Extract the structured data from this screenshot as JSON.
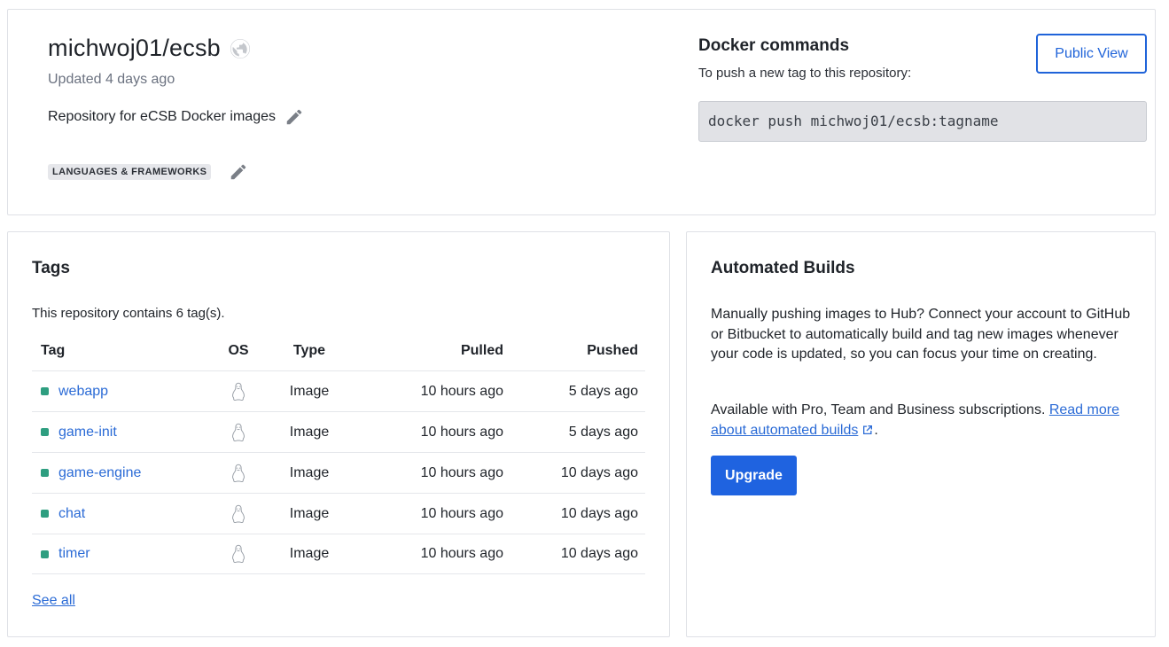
{
  "repo": {
    "name": "michwoj01/ecsb",
    "visibility_icon": "globe-icon",
    "updated": "Updated 4 days ago",
    "description": "Repository for eCSB Docker images",
    "category": "LANGUAGES & FRAMEWORKS"
  },
  "docker": {
    "title": "Docker commands",
    "subtitle": "To push a new tag to this repository:",
    "command": "docker push michwoj01/ecsb:tagname",
    "public_view_label": "Public View"
  },
  "tags": {
    "title": "Tags",
    "count_text": "This repository contains 6 tag(s).",
    "columns": {
      "tag": "Tag",
      "os": "OS",
      "type": "Type",
      "pulled": "Pulled",
      "pushed": "Pushed"
    },
    "rows": [
      {
        "tag": "webapp",
        "os_icon": "linux-icon",
        "type": "Image",
        "pulled": "10 hours ago",
        "pushed": "5 days ago"
      },
      {
        "tag": "game-init",
        "os_icon": "linux-icon",
        "type": "Image",
        "pulled": "10 hours ago",
        "pushed": "5 days ago"
      },
      {
        "tag": "game-engine",
        "os_icon": "linux-icon",
        "type": "Image",
        "pulled": "10 hours ago",
        "pushed": "10 days ago"
      },
      {
        "tag": "chat",
        "os_icon": "linux-icon",
        "type": "Image",
        "pulled": "10 hours ago",
        "pushed": "10 days ago"
      },
      {
        "tag": "timer",
        "os_icon": "linux-icon",
        "type": "Image",
        "pulled": "10 hours ago",
        "pushed": "10 days ago"
      }
    ],
    "see_all_label": "See all",
    "status_color": "#2e9e80"
  },
  "builds": {
    "title": "Automated Builds",
    "body": "Manually pushing images to Hub? Connect your account to GitHub or Bitbucket to automatically build and tag new images whenever your code is updated, so you can focus your time on creating.",
    "avail_prefix": "Available with Pro, Team and Business subscriptions. ",
    "read_more_label": "Read more about automated builds",
    "avail_suffix": ".",
    "upgrade_label": "Upgrade"
  },
  "colors": {
    "accent": "#1f63e0",
    "link": "#2b6bd6"
  }
}
